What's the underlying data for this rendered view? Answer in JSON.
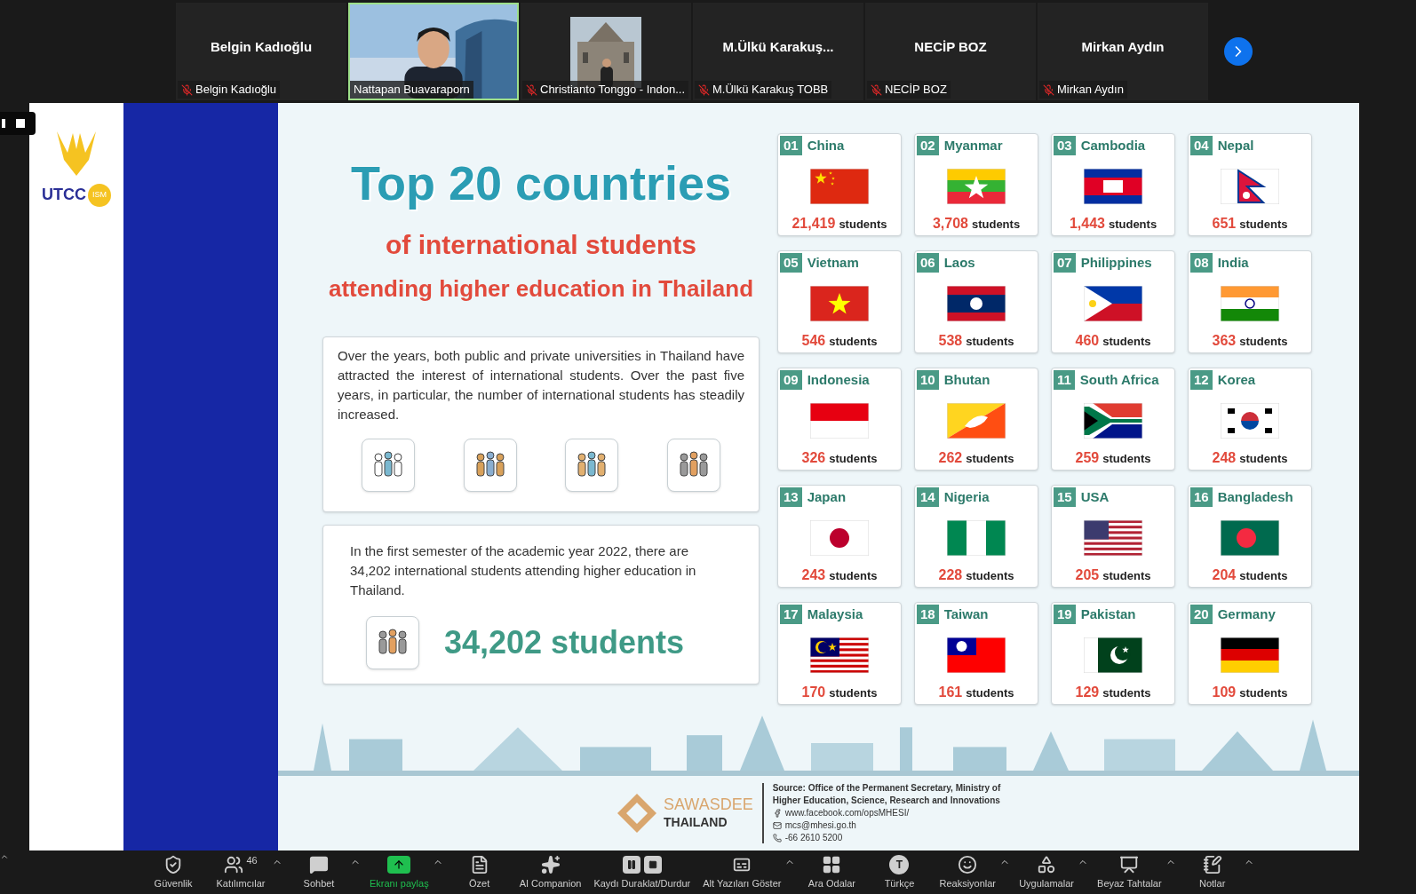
{
  "participants": [
    {
      "kind": "name",
      "name": "Belgin Kadıoğlu",
      "label": "Belgin Kadıoğlu",
      "muted": true,
      "speaking": false
    },
    {
      "kind": "video",
      "label": "Nattapan Buavaraporn",
      "muted": false,
      "speaking": true
    },
    {
      "kind": "video",
      "label": "Christianto Tonggo - Indon...",
      "muted": true,
      "speaking": false
    },
    {
      "kind": "name",
      "name": "M.Ülkü  Karakuş...",
      "label": "M.Ülkü Karakuş TOBB",
      "muted": true,
      "speaking": false
    },
    {
      "kind": "name",
      "name": "NECİP BOZ",
      "label": "NECİP BOZ",
      "muted": true,
      "speaking": false
    },
    {
      "kind": "name",
      "name": "Mirkan Aydın",
      "label": "Mirkan Aydın",
      "muted": true,
      "speaking": false
    }
  ],
  "logo": {
    "text": "UTCC",
    "badge": "ISM"
  },
  "slide": {
    "title": "Top 20 countries",
    "subtitle": "of international students",
    "subtitle_2": "attending higher education in Thailand",
    "intro": "Over the years, both public and private universities in Thailand have attracted the interest of international students. Over the past five years, in particular, the number of international students has steadily increased.",
    "summary": "In the first semester of the academic year 2022, there are 34,202 international students attending higher education in Thailand.",
    "total": "34,202 students",
    "countries": [
      {
        "rank": "01",
        "name": "China",
        "kind": "cn",
        "count": "21,419",
        "unit": "students"
      },
      {
        "rank": "02",
        "name": "Myanmar",
        "kind": "mm",
        "count": "3,708",
        "unit": "students"
      },
      {
        "rank": "03",
        "name": "Cambodia",
        "kind": "kh",
        "count": "1,443",
        "unit": "students"
      },
      {
        "rank": "04",
        "name": "Nepal",
        "kind": "np",
        "count": "651",
        "unit": "students"
      },
      {
        "rank": "05",
        "name": "Vietnam",
        "kind": "vn",
        "count": "546",
        "unit": "students"
      },
      {
        "rank": "06",
        "name": "Laos",
        "kind": "la",
        "count": "538",
        "unit": "students"
      },
      {
        "rank": "07",
        "name": "Philippines",
        "kind": "ph",
        "count": "460",
        "unit": "students"
      },
      {
        "rank": "08",
        "name": "India",
        "kind": "in",
        "count": "363",
        "unit": "students"
      },
      {
        "rank": "09",
        "name": "Indonesia",
        "kind": "id",
        "count": "326",
        "unit": "students"
      },
      {
        "rank": "10",
        "name": "Bhutan",
        "kind": "bt",
        "count": "262",
        "unit": "students"
      },
      {
        "rank": "11",
        "name": "South Africa",
        "kind": "za",
        "count": "259",
        "unit": "students"
      },
      {
        "rank": "12",
        "name": "Korea",
        "kind": "kr",
        "count": "248",
        "unit": "students"
      },
      {
        "rank": "13",
        "name": "Japan",
        "kind": "jp",
        "count": "243",
        "unit": "students"
      },
      {
        "rank": "14",
        "name": "Nigeria",
        "kind": "ng",
        "count": "228",
        "unit": "students"
      },
      {
        "rank": "15",
        "name": "USA",
        "kind": "us",
        "count": "205",
        "unit": "students"
      },
      {
        "rank": "16",
        "name": "Bangladesh",
        "kind": "bd",
        "count": "204",
        "unit": "students"
      },
      {
        "rank": "17",
        "name": "Malaysia",
        "kind": "my",
        "count": "170",
        "unit": "students"
      },
      {
        "rank": "18",
        "name": "Taiwan",
        "kind": "tw",
        "count": "161",
        "unit": "students"
      },
      {
        "rank": "19",
        "name": "Pakistan",
        "kind": "pk",
        "count": "129",
        "unit": "students"
      },
      {
        "rank": "20",
        "name": "Germany",
        "kind": "de",
        "count": "109",
        "unit": "students"
      }
    ],
    "footer": {
      "brand": "SAWASDEE",
      "brand_2": "THAILAND",
      "source": "Source: Office of the Permanent Secretary, Ministry of Higher Education, Science, Research and Innovations",
      "facebook": "www.facebook.com/opsMHESI/",
      "email": "mcs@mhesi.go.th",
      "phone": "-66 2610 5200"
    }
  },
  "toolbar": [
    {
      "kind": "shield",
      "label": "Güvenlik",
      "caret": false
    },
    {
      "kind": "people",
      "label": "Katılımcılar",
      "count": "46",
      "caret": true
    },
    {
      "kind": "chat",
      "label": "Sohbet",
      "caret": true
    },
    {
      "kind": "share",
      "label": "Ekranı paylaş",
      "caret": true
    },
    {
      "kind": "summary",
      "label": "Özet",
      "caret": false
    },
    {
      "kind": "sparkle",
      "label": "AI Companion",
      "caret": false
    },
    {
      "kind": "record",
      "label": "Kaydı Duraklat/Durdur",
      "caret": false
    },
    {
      "kind": "cc",
      "label": "Alt Yazıları Göster",
      "caret": true
    },
    {
      "kind": "grid",
      "label": "Ara Odalar",
      "caret": false
    },
    {
      "kind": "language",
      "label": "Türkçe",
      "badge": "T",
      "caret": false
    },
    {
      "kind": "smile",
      "label": "Reaksiyonlar",
      "caret": true
    },
    {
      "kind": "apps",
      "label": "Uygulamalar",
      "caret": true
    },
    {
      "kind": "whiteboard",
      "label": "Beyaz Tahtalar",
      "caret": true
    },
    {
      "kind": "notes",
      "label": "Notlar",
      "caret": true
    }
  ]
}
